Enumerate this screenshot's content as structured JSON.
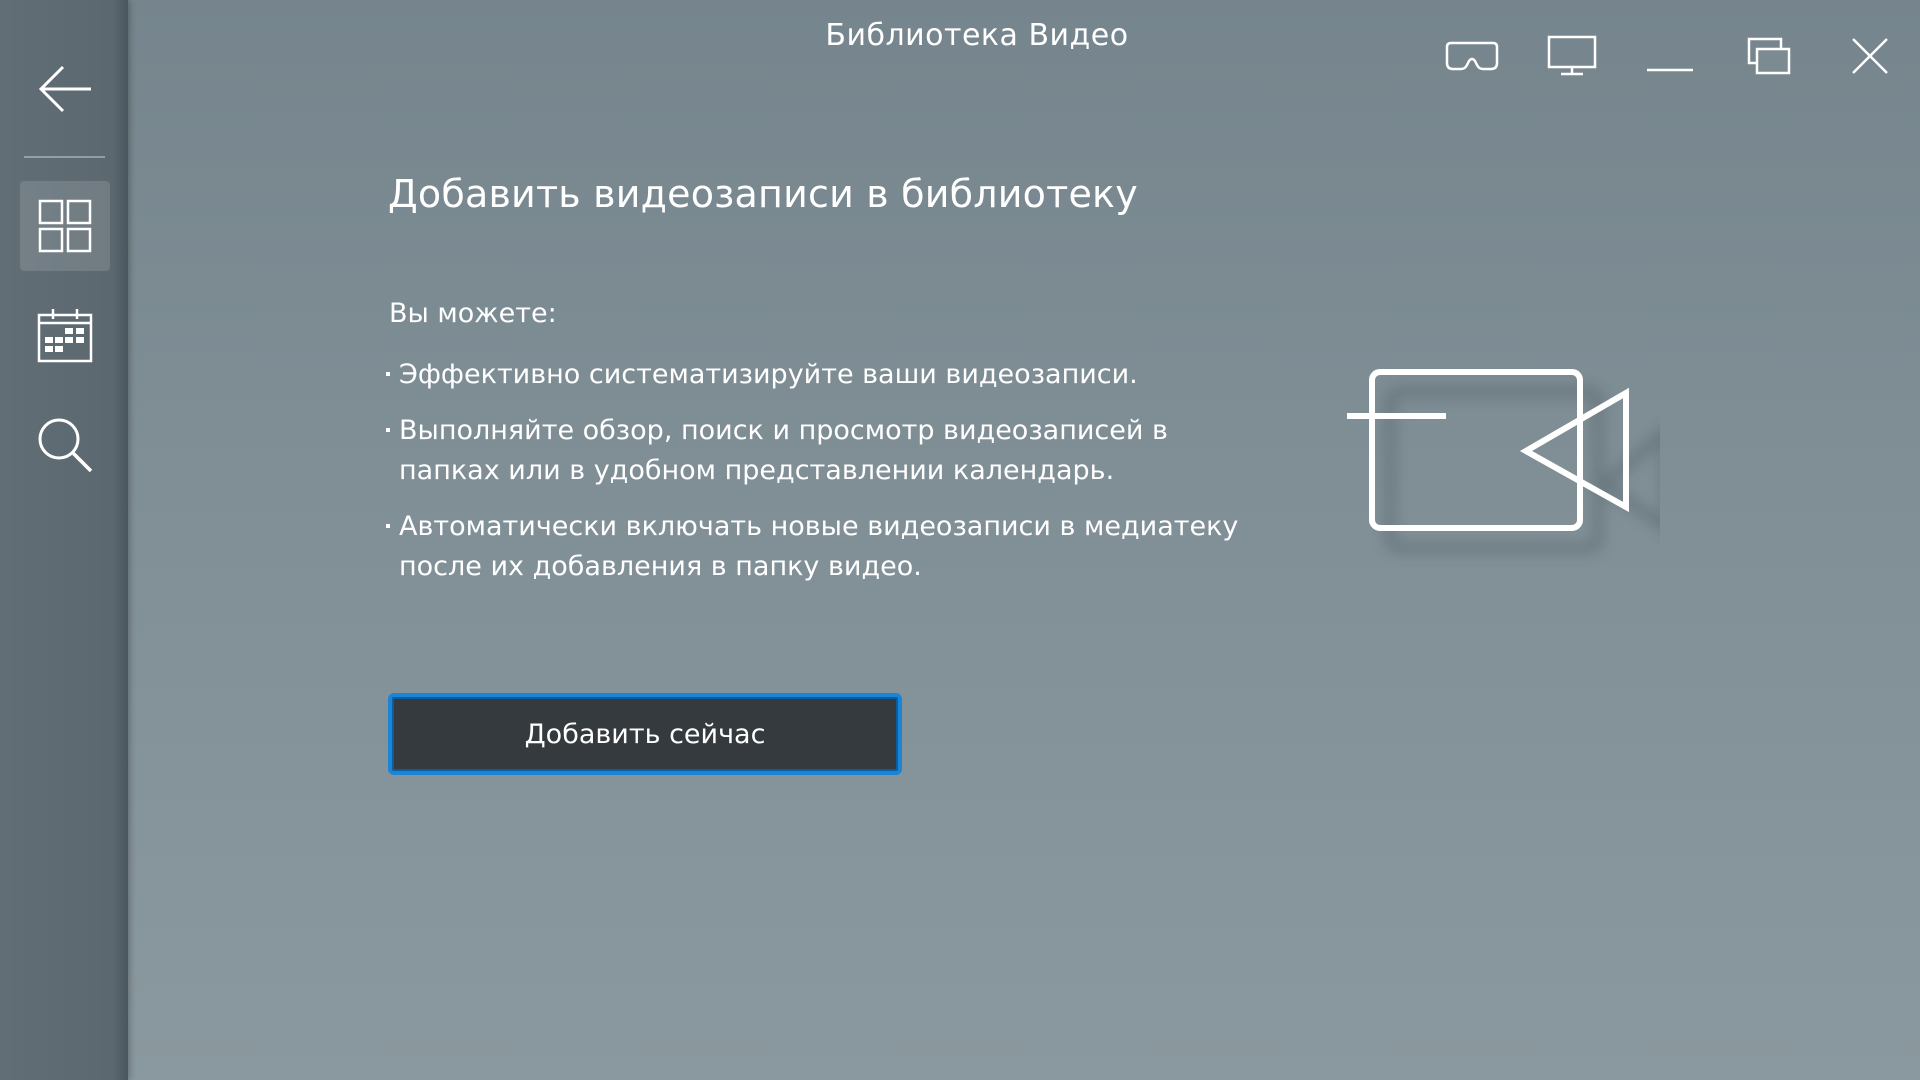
{
  "app": {
    "title": "Библиотека Видео"
  },
  "sidebar": {
    "items": [
      {
        "id": "back",
        "icon": "back-arrow-icon"
      },
      {
        "id": "library",
        "icon": "grid-icon",
        "active": true
      },
      {
        "id": "calendar",
        "icon": "calendar-icon"
      },
      {
        "id": "search",
        "icon": "search-icon"
      }
    ]
  },
  "window_controls": [
    {
      "id": "vr",
      "icon": "vr-headset-icon"
    },
    {
      "id": "display",
      "icon": "monitor-icon"
    },
    {
      "id": "minimize",
      "icon": "minimize-icon"
    },
    {
      "id": "restore",
      "icon": "restore-icon"
    },
    {
      "id": "close",
      "icon": "close-icon"
    }
  ],
  "main": {
    "heading": "Добавить видеозаписи в библиотеку",
    "intro": "Вы можете:",
    "features": [
      "Эффективно систематизируйте ваши видеозаписи.",
      "Выполняйте обзор, поиск и просмотр видеозаписей в папках или в удобном представлении календарь.",
      "Автоматически включать новые видеозаписи в медиатеку после их добавления в папку видео."
    ],
    "add_button_label": "Добавить сейчас",
    "illustration_icon": "video-camera-icon"
  },
  "colors": {
    "accent": "#1a85d6",
    "button_bg": "#343a3e",
    "sidebar_bg": "#5f6c74",
    "content_bg": "#808f96"
  }
}
